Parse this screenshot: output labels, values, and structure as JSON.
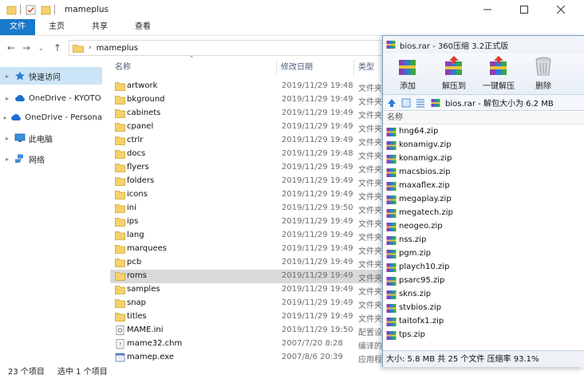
{
  "explorer": {
    "title": "mameplus",
    "ribbon_tabs": [
      "文件",
      "主页",
      "共享",
      "查看"
    ],
    "address": {
      "path": "mameplus"
    },
    "nav": [
      {
        "label": "快速访问",
        "icon": "star-icon",
        "selected": true
      },
      {
        "label": "OneDrive - KYOTO",
        "icon": "cloud-icon"
      },
      {
        "label": "OneDrive - Persona",
        "icon": "cloud-icon"
      },
      {
        "label": "此电脑",
        "icon": "computer-icon"
      },
      {
        "label": "网络",
        "icon": "network-icon"
      }
    ],
    "columns": {
      "name": "名称",
      "date": "修改日期",
      "type": "类型"
    },
    "files": [
      {
        "name": "artwork",
        "date": "2019/11/29 19:48",
        "type": "文件夹",
        "icon": "folder-icon"
      },
      {
        "name": "bkground",
        "date": "2019/11/29 19:49",
        "type": "文件夹",
        "icon": "folder-icon"
      },
      {
        "name": "cabinets",
        "date": "2019/11/29 19:49",
        "type": "文件夹",
        "icon": "folder-icon"
      },
      {
        "name": "cpanel",
        "date": "2019/11/29 19:49",
        "type": "文件夹",
        "icon": "folder-icon"
      },
      {
        "name": "ctrlr",
        "date": "2019/11/29 19:49",
        "type": "文件夹",
        "icon": "folder-icon"
      },
      {
        "name": "docs",
        "date": "2019/11/29 19:48",
        "type": "文件夹",
        "icon": "folder-icon"
      },
      {
        "name": "flyers",
        "date": "2019/11/29 19:49",
        "type": "文件夹",
        "icon": "folder-icon"
      },
      {
        "name": "folders",
        "date": "2019/11/29 19:49",
        "type": "文件夹",
        "icon": "folder-icon"
      },
      {
        "name": "icons",
        "date": "2019/11/29 19:49",
        "type": "文件夹",
        "icon": "folder-icon"
      },
      {
        "name": "ini",
        "date": "2019/11/29 19:50",
        "type": "文件夹",
        "icon": "folder-icon"
      },
      {
        "name": "ips",
        "date": "2019/11/29 19:49",
        "type": "文件夹",
        "icon": "folder-icon"
      },
      {
        "name": "lang",
        "date": "2019/11/29 19:49",
        "type": "文件夹",
        "icon": "folder-icon"
      },
      {
        "name": "marquees",
        "date": "2019/11/29 19:49",
        "type": "文件夹",
        "icon": "folder-icon"
      },
      {
        "name": "pcb",
        "date": "2019/11/29 19:49",
        "type": "文件夹",
        "icon": "folder-icon"
      },
      {
        "name": "roms",
        "date": "2019/11/29 19:49",
        "type": "文件夹",
        "icon": "folder-icon",
        "selected": true
      },
      {
        "name": "samples",
        "date": "2019/11/29 19:49",
        "type": "文件夹",
        "icon": "folder-icon"
      },
      {
        "name": "snap",
        "date": "2019/11/29 19:49",
        "type": "文件夹",
        "icon": "folder-icon"
      },
      {
        "name": "titles",
        "date": "2019/11/29 19:49",
        "type": "文件夹",
        "icon": "folder-icon"
      },
      {
        "name": "MAME.ini",
        "date": "2019/11/29 19:50",
        "type": "配置设",
        "icon": "ini-file-icon"
      },
      {
        "name": "mame32.chm",
        "date": "2007/7/20 8:28",
        "type": "编译的",
        "icon": "chm-file-icon"
      },
      {
        "name": "mamep.exe",
        "date": "2007/8/6 20:39",
        "type": "应用程",
        "icon": "exe-file-icon"
      }
    ],
    "status": {
      "count": "23 个项目",
      "selected": "选中 1 个项目"
    }
  },
  "archive": {
    "title": "bios.rar - 360压缩 3.2正式版",
    "toolbar": [
      {
        "label": "添加",
        "icon": "add-archive-icon"
      },
      {
        "label": "解压到",
        "icon": "extract-to-icon"
      },
      {
        "label": "一键解压",
        "icon": "one-click-extract-icon"
      },
      {
        "label": "删除",
        "icon": "trash-icon"
      }
    ],
    "path_text": "bios.rar - 解包大小为 6.2 MB",
    "column_name": "名称",
    "files": [
      "hng64.zip",
      "konamigv.zip",
      "konamigx.zip",
      "macsbios.zip",
      "maxaflex.zip",
      "megaplay.zip",
      "megatech.zip",
      "neogeo.zip",
      "nss.zip",
      "pgm.zip",
      "playch10.zip",
      "psarc95.zip",
      "skns.zip",
      "stvbios.zip",
      "taitofx1.zip",
      "tps.zip"
    ],
    "status": "大小: 5.8 MB 共 25 个文件 压缩率 93.1%"
  },
  "colors": {
    "accent": "#1979ca",
    "nav_selected": "#cce4f7",
    "row_selected": "#d9d9d9",
    "folder": "#f0c24b"
  }
}
